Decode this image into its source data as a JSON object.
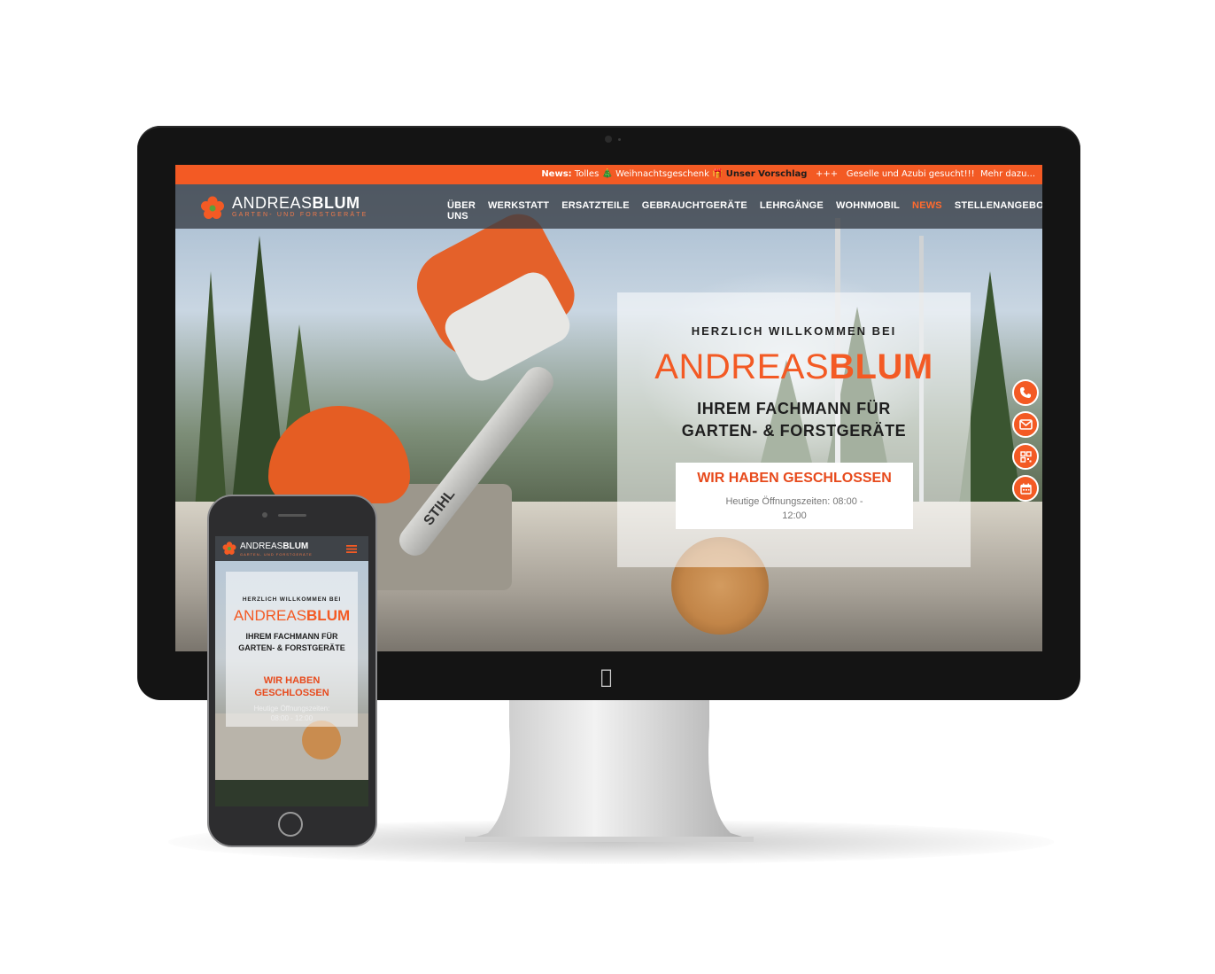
{
  "ticker": {
    "news_label": "News:",
    "news_text": "Tolles 🎄 Weihnachtsgeschenk 🎁",
    "news_link": "Unser Vorschlag",
    "separator": "+++",
    "jobs_text": "Geselle und Azubi gesucht!!!",
    "jobs_link": "Mehr dazu..."
  },
  "logo": {
    "name_light": "ANDREAS",
    "name_bold": "BLUM",
    "subtitle": "GARTEN- UND FORSTGERÄTE"
  },
  "nav": {
    "items": [
      {
        "label": "ÜBER UNS"
      },
      {
        "label": "WERKSTATT"
      },
      {
        "label": "ERSATZTEILE"
      },
      {
        "label": "GEBRAUCHTGERÄTE"
      },
      {
        "label": "LEHRGÄNGE"
      },
      {
        "label": "WOHNMOBIL"
      },
      {
        "label": "NEWS"
      },
      {
        "label": "STELLENANGEBOTE"
      }
    ],
    "active": "NEWS"
  },
  "hero": {
    "welcome": "HERZLICH WILLKOMMEN BEI",
    "brand_light": "ANDREAS",
    "brand_bold": "BLUM",
    "tagline_1": "IHREM FACHMANN FÜR",
    "tagline_2": "GARTEN- & FORSTGERÄTE",
    "status": "WIR HABEN GESCHLOSSEN",
    "hours_1": "Heutige Öffnungszeiten: 08:00 -",
    "hours_2": "12:00"
  },
  "saw_brand": "STIHL",
  "side_buttons": [
    {
      "icon": "phone-icon"
    },
    {
      "icon": "mail-icon"
    },
    {
      "icon": "qr-code-icon"
    },
    {
      "icon": "calendar-icon"
    }
  ],
  "mobile": {
    "welcome": "HERZLICH WILLKOMMEN BEI",
    "brand_light": "ANDREAS",
    "brand_bold": "BLUM",
    "tagline_1": "IHREM FACHMANN FÜR",
    "tagline_2": "GARTEN- & FORSTGERÄTE",
    "status_1": "WIR HABEN",
    "status_2": "GESCHLOSSEN",
    "hours_1": "Heutige Öffnungszeiten:",
    "hours_2": "08:00 - 12:00"
  },
  "colors": {
    "accent": "#f35a24",
    "nav_bg": "#373c44",
    "monitor_bezel": "#141414"
  }
}
